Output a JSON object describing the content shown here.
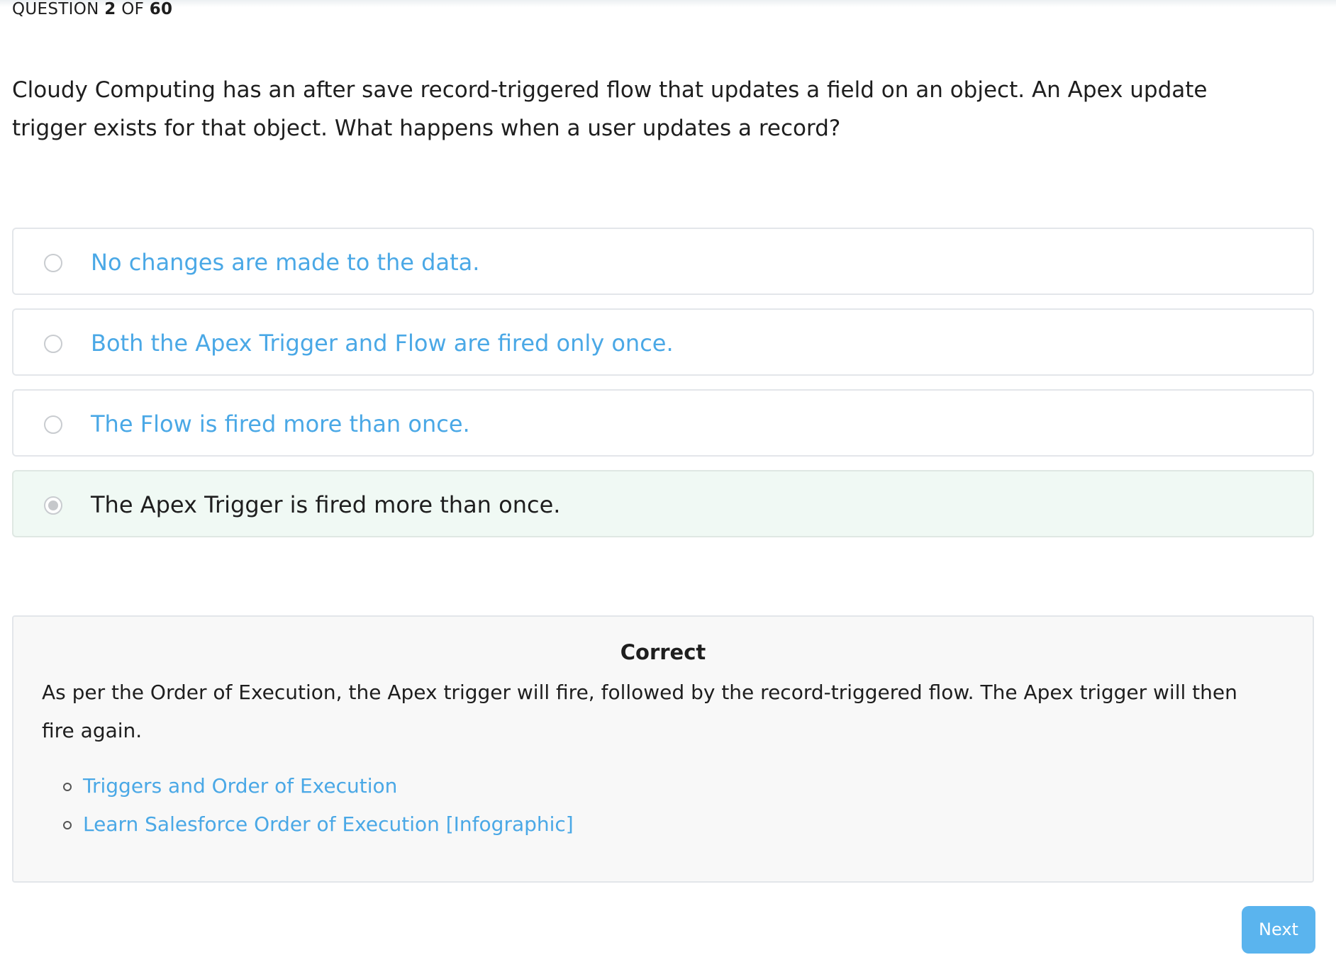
{
  "header": {
    "prefix": "QUESTION",
    "current": "2",
    "of": "OF",
    "total": "60"
  },
  "question": {
    "text": "Cloudy Computing has an after save record-triggered flow that updates a field on an object. An Apex update trigger exists for that object. What happens when a user updates a record?"
  },
  "options": [
    {
      "label": "No changes are made to the data.",
      "selected": false
    },
    {
      "label": "Both the Apex Trigger and Flow are fired only once.",
      "selected": false
    },
    {
      "label": "The Flow is fired more than once.",
      "selected": false
    },
    {
      "label": "The Apex Trigger is fired more than once.",
      "selected": true
    }
  ],
  "explanation": {
    "title": "Correct",
    "text": "As per the Order of Execution, the Apex trigger will fire, followed by the record-triggered flow. The Apex trigger will then fire again.",
    "links": [
      "Triggers and Order of Execution",
      "Learn Salesforce Order of Execution [Infographic]"
    ]
  },
  "actions": {
    "next_label": "Next"
  },
  "colors": {
    "link": "#4aa8e6",
    "selected_bg": "#f0f9f4",
    "button": "#5ab4ee"
  }
}
